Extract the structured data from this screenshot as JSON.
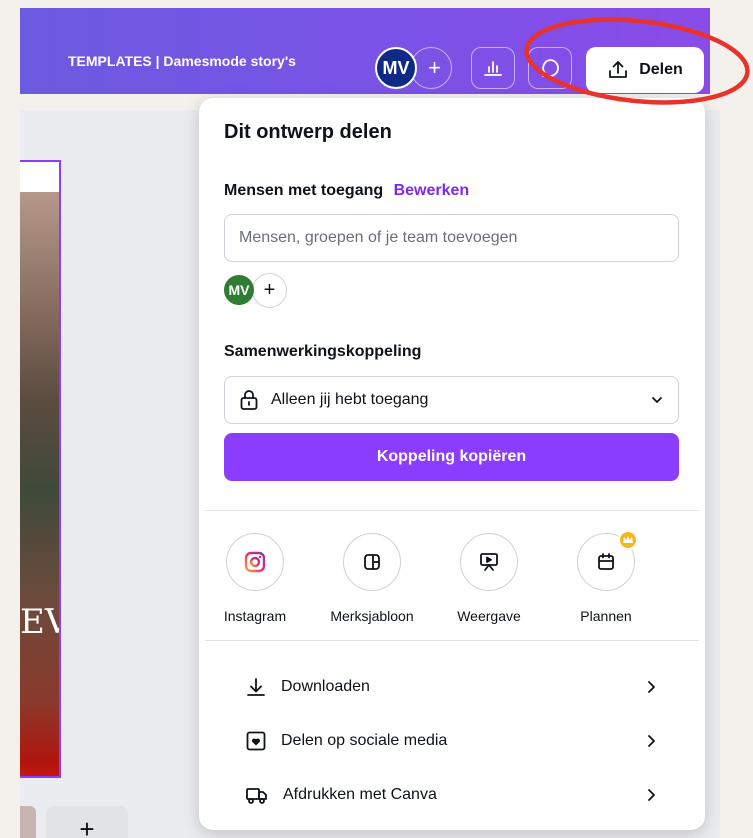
{
  "header": {
    "doc_title": "TEMPLATES | Damesmode story's",
    "avatar_initials": "MV",
    "add_collaborator": "+",
    "share_label": "Delen"
  },
  "canvas": {
    "frame_text": "EV",
    "thumb_add": "+"
  },
  "share_panel": {
    "title": "Dit ontwerp delen",
    "access_label": "Mensen met toegang",
    "edit_link": "Bewerken",
    "people_input_placeholder": "Mensen, groepen of je team toevoegen",
    "people_input_value": "",
    "member_initials": "MV",
    "member_add": "+",
    "collab_link_label": "Samenwerkingskoppeling",
    "access_value": "Alleen jij hebt toegang",
    "copy_link_label": "Koppeling kopiëren",
    "options": [
      {
        "label": "Instagram",
        "icon": "instagram-icon"
      },
      {
        "label": "Merksjabloon",
        "icon": "brand-template-icon"
      },
      {
        "label": "Weergave",
        "icon": "presentation-icon"
      },
      {
        "label": "Plannen",
        "icon": "calendar-icon",
        "badge": "crown-icon"
      }
    ],
    "actions": [
      {
        "label": "Downloaden",
        "icon": "download-icon"
      },
      {
        "label": "Delen op sociale media",
        "icon": "social-heart-icon"
      },
      {
        "label": "Afdrukken met Canva",
        "icon": "print-truck-icon"
      }
    ]
  },
  "colors": {
    "header_gradient_start": "#6c5ae0",
    "header_gradient_end": "#8a4be8",
    "accent_purple": "#8b3dff",
    "edit_link": "#7d2ae8",
    "annotation_circle": "#e8322b",
    "crown_badge": "#f5b71f"
  }
}
